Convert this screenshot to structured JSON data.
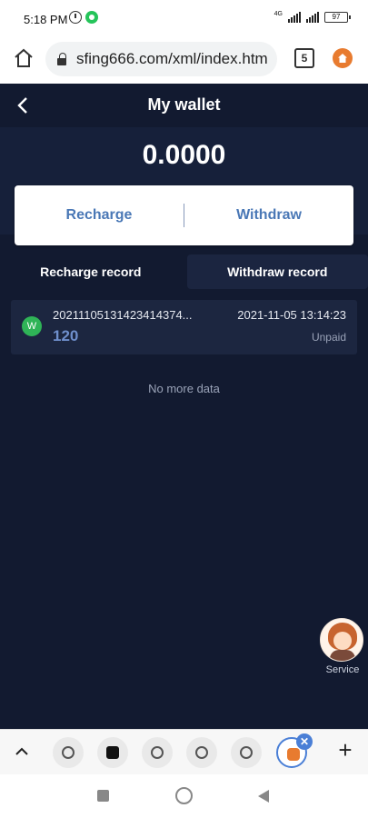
{
  "status_bar": {
    "time": "5:18 PM",
    "battery": "97",
    "network": "4G"
  },
  "browser": {
    "url": "sfing666.com/xml/index.htm",
    "tab_count": "5"
  },
  "app": {
    "title": "My wallet",
    "balance": "0.0000",
    "actions": {
      "recharge": "Recharge",
      "withdraw": "Withdraw"
    },
    "tabs": {
      "recharge_record": "Recharge record",
      "withdraw_record": "Withdraw record"
    },
    "records": [
      {
        "badge": "W",
        "order_id": "20211105131423414374...",
        "amount": "120",
        "time": "2021-11-05 13:14:23",
        "status": "Unpaid"
      }
    ],
    "no_more": "No more data",
    "service_label": "Service"
  },
  "colors": {
    "app_bg": "#121a30",
    "accent": "#4a78b6",
    "badge_green": "#2fb457",
    "amount_blue": "#6f8fcc"
  }
}
